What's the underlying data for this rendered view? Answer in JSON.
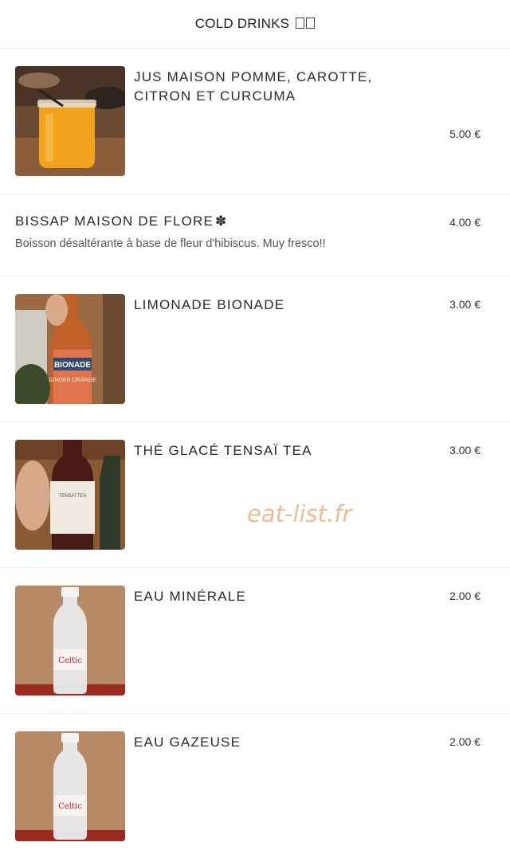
{
  "header": {
    "title": "COLD DRINKS",
    "emoji_glyphs": "two-unrendered-emoji-boxes"
  },
  "items": [
    {
      "name": "JUS MAISON POMME, CAROTTE, CITRON ET CURCUMA",
      "line1": "JUS MAISON POMME, CAROTTE,",
      "line2": "CITRON ET CURCUMA",
      "price": "5.00 €",
      "image": "orange-juice-jar-photo"
    },
    {
      "name": "BISSAP MAISON DE FLORE",
      "flower_glyph": "✽",
      "description": "Boisson désaltérante à base de fleur d'hibiscus. Muy fresco!!",
      "price": "4.00 €"
    },
    {
      "name": "LIMONADE BIONADE",
      "price": "3.00 €",
      "image": "bionade-ginger-bottle-photo",
      "bottle_label": "BIONADE",
      "bottle_sub": "GINGER ORANGE"
    },
    {
      "name": "THÉ GLACÉ TENSAÏ TEA",
      "price": "3.00 €",
      "image": "tensai-tea-bottle-photo",
      "bottle_label": "TENSAÏ TEA"
    },
    {
      "name": "EAU MINÉRALE",
      "price": "2.00 €",
      "image": "celtic-water-bottle-photo",
      "bottle_label": "Celtic"
    },
    {
      "name": "EAU GAZEUSE",
      "price": "2.00 €",
      "image": "celtic-water-bottle-photo",
      "bottle_label": "Celtic"
    }
  ],
  "watermark": "eat-list.fr",
  "colors": {
    "watermark": "#f0b48a",
    "divider": "#ececec",
    "text": "#2a2a2a"
  }
}
